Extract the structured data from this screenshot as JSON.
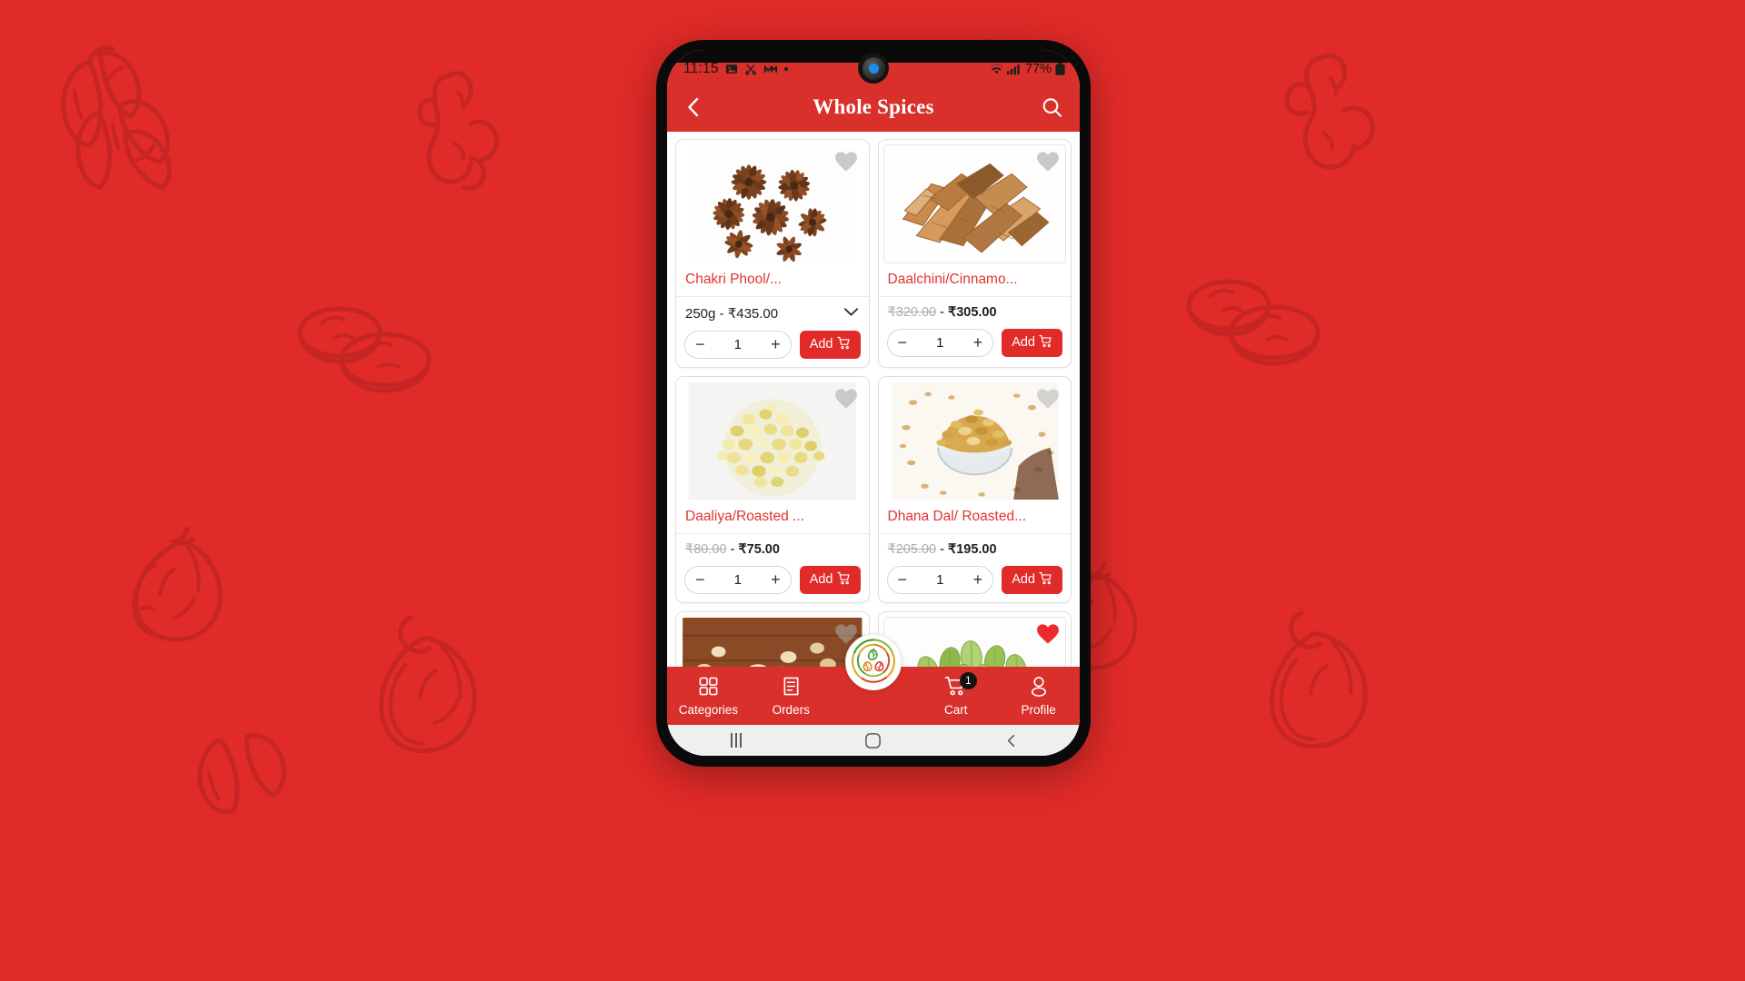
{
  "theme": {
    "brand_red": "#e02b28",
    "header_red": "#d9302c",
    "price_old": "#adadad",
    "badge_black": "#141414"
  },
  "statusbar": {
    "time": "11:15",
    "icons_left": [
      "photo-icon",
      "scissors-icon",
      "music-icon",
      "dot-icon"
    ],
    "wifi": "wifi-icon",
    "signal": "cellular-signal-icon",
    "battery_percent": "77%",
    "battery": "battery-icon"
  },
  "appbar": {
    "back_icon": "chevron-left-icon",
    "title": "Whole Spices",
    "search_icon": "search-icon"
  },
  "products": [
    {
      "name": "Chakri Phool/...",
      "image": "star-anise",
      "favorite": false,
      "has_variant": true,
      "variant": "250g - ₹435.00",
      "price_old": "",
      "price_new": "",
      "qty": "1",
      "add_label": "Add"
    },
    {
      "name": "Daalchini/Cinnamo...",
      "image": "cinnamon-bark",
      "favorite": false,
      "has_variant": false,
      "variant": "",
      "price_old": "₹320.00",
      "price_sep": "-",
      "price_new": "₹305.00",
      "qty": "1",
      "add_label": "Add"
    },
    {
      "name": "Daaliya/Roasted ...",
      "image": "roasted-gram",
      "favorite": false,
      "has_variant": false,
      "variant": "",
      "price_old": "₹80.00",
      "price_sep": "-",
      "price_new": "₹75.00",
      "qty": "1",
      "add_label": "Add"
    },
    {
      "name": "Dhana Dal/ Roasted...",
      "image": "dhana-dal",
      "favorite": false,
      "has_variant": false,
      "variant": "",
      "price_old": "₹205.00",
      "price_sep": "-",
      "price_new": "₹195.00",
      "qty": "1",
      "add_label": "Add"
    },
    {
      "name": "",
      "image": "gond-edible-gum",
      "favorite": false,
      "has_variant": false,
      "variant": "",
      "price_old": "",
      "price_new": "",
      "qty": "",
      "add_label": ""
    },
    {
      "name": "",
      "image": "green-cardamom",
      "favorite": true,
      "has_variant": false,
      "variant": "",
      "price_old": "",
      "price_new": "",
      "qty": "",
      "add_label": ""
    }
  ],
  "bottomnav": {
    "items": [
      {
        "label": "Categories",
        "icon": "grid-icon"
      },
      {
        "label": "Orders",
        "icon": "receipt-icon"
      },
      {
        "label": "Cart",
        "icon": "cart-icon",
        "badge": "1"
      },
      {
        "label": "Profile",
        "icon": "person-icon"
      }
    ],
    "fab_icon": "app-logo-leaves"
  },
  "sysnav": {
    "recents_icon": "recents-icon",
    "home_icon": "home-icon",
    "back_icon": "back-icon"
  },
  "background": {
    "motifs": [
      "cardamom-pods",
      "ginger-root",
      "star-anise-outline",
      "chili-pepper",
      "garlic-bulb",
      "spice-bowl",
      "almond"
    ]
  }
}
